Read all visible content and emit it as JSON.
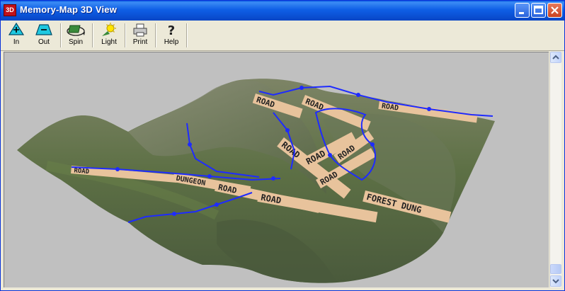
{
  "window": {
    "title": "Memory-Map 3D View",
    "icon_label": "3D"
  },
  "toolbar": {
    "zoom_in_label": "In",
    "zoom_out_label": "Out",
    "spin_label": "Spin",
    "light_label": "Light",
    "print_label": "Print",
    "help_label": "Help"
  },
  "scene": {
    "road_labels": [
      "ROAD",
      "ROAD",
      "ROAD",
      "ROAD",
      "ROAD",
      "ROAD",
      "ROAD",
      "DUNGEON",
      "ROAD",
      "ROAD",
      "ROAD",
      "FOREST DUNG"
    ],
    "track_color": "#1e2bff"
  }
}
